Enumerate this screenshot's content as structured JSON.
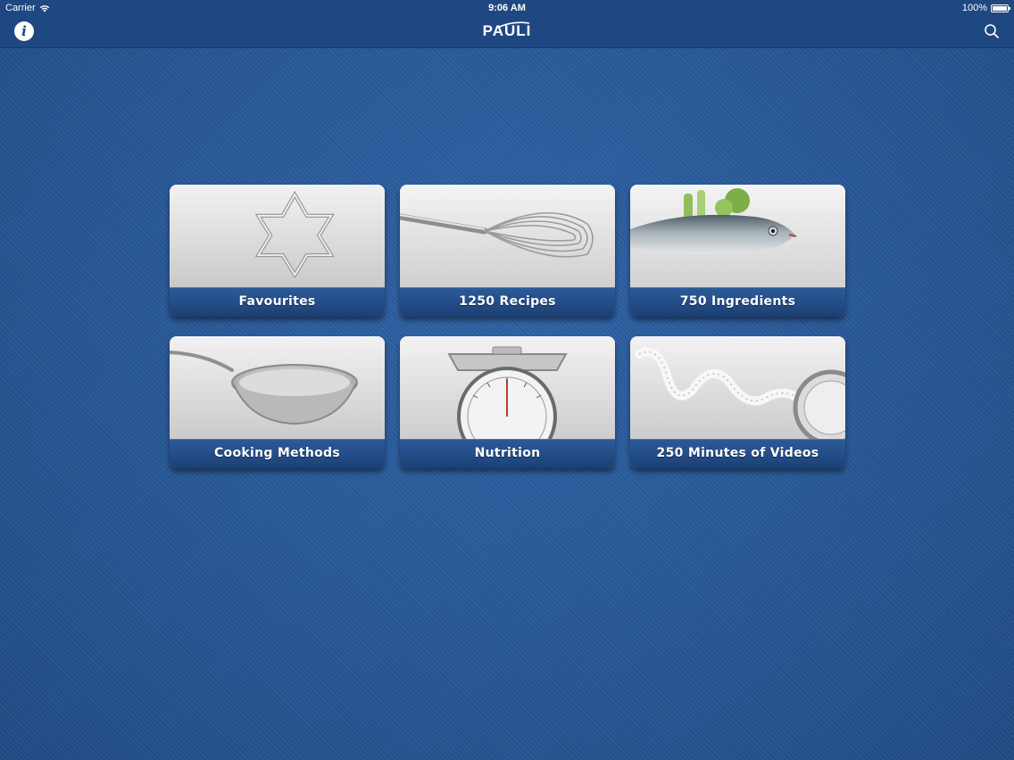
{
  "status_bar": {
    "carrier": "Carrier",
    "time": "9:06 AM",
    "battery": "100%"
  },
  "nav_bar": {
    "info_icon": "info-icon",
    "logo": "PAULI",
    "search_icon": "search-icon"
  },
  "tiles": [
    {
      "label": "Favourites",
      "icon": "star-cookie-cutter"
    },
    {
      "label": "1250 Recipes",
      "icon": "whisk"
    },
    {
      "label": "750 Ingredients",
      "icon": "fish"
    },
    {
      "label": "Cooking Methods",
      "icon": "frying-pan"
    },
    {
      "label": "Nutrition",
      "icon": "kitchen-scale"
    },
    {
      "label": "250 Minutes of Videos",
      "icon": "measuring-tape"
    }
  ],
  "colors": {
    "background": "#2a5c9e",
    "nav_bar": "#1f4781",
    "tile_label": "#224b85"
  }
}
